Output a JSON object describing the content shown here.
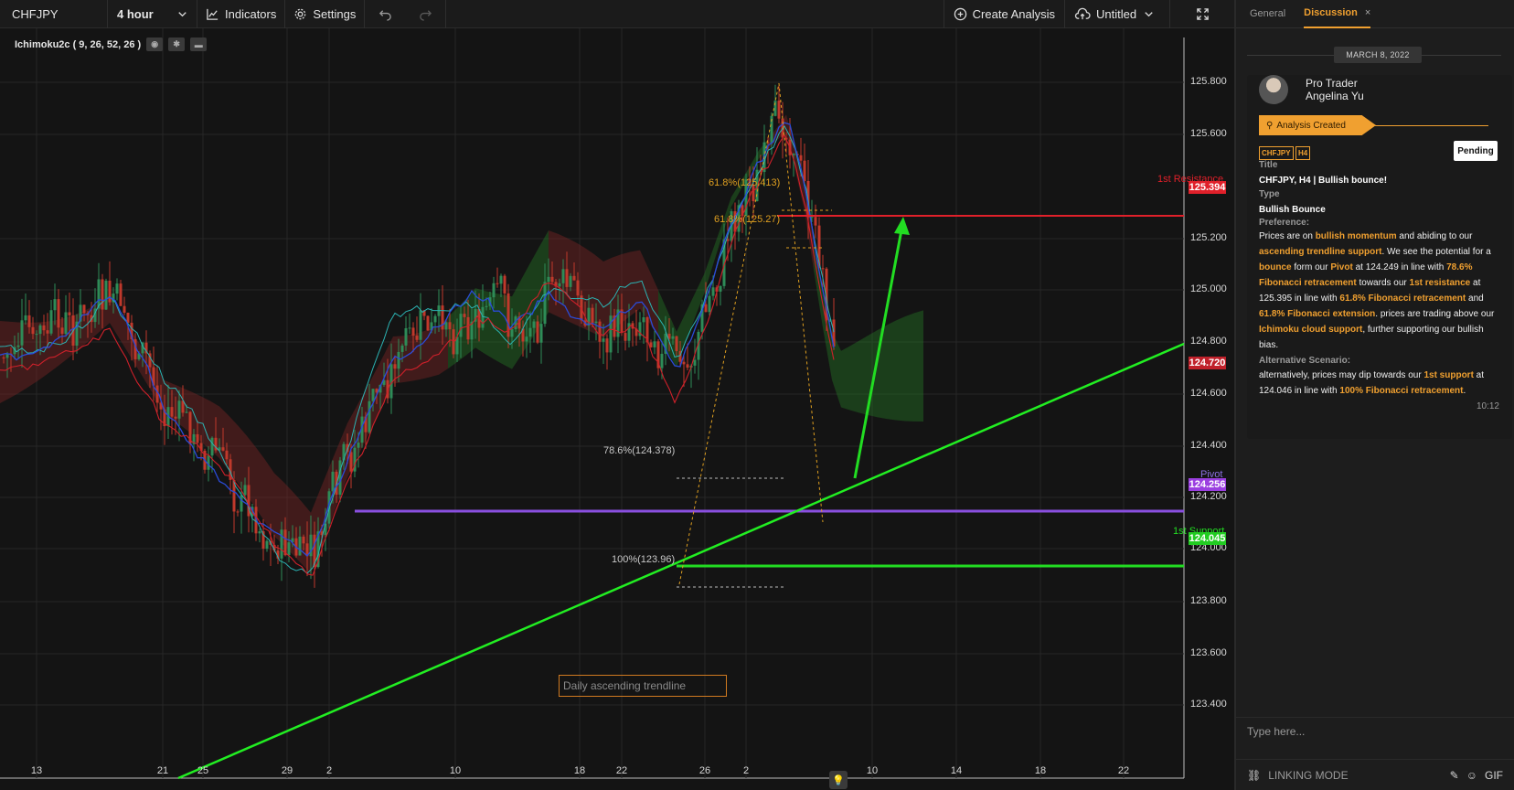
{
  "toolbar": {
    "symbol": "CHFJPY",
    "interval": "4 hour",
    "indicators_label": "Indicators",
    "settings_label": "Settings",
    "create_label": "Create Analysis",
    "layout_label": "Untitled"
  },
  "indicator": {
    "label": "Ichimoku2c ( 9, 26, 52, 26 )"
  },
  "price_axis": [
    "125.800",
    "125.600",
    "125.200",
    "125.000",
    "124.800",
    "124.600",
    "124.400",
    "124.200",
    "124.000",
    "123.800",
    "123.600",
    "123.400"
  ],
  "time_axis": [
    "13",
    "21",
    "25",
    "29",
    "2",
    "10",
    "18",
    "22",
    "26",
    "2",
    "10",
    "14",
    "18",
    "22"
  ],
  "price_tags": {
    "resistance": "125.394",
    "current": "124.720",
    "pivot": "124.256",
    "support": "124.045"
  },
  "levels": {
    "resistance": "1st Resistance",
    "pivot": "Pivot",
    "support": "1st Support"
  },
  "fib": {
    "f618": "61.8%(125.413)",
    "f50": "61.8%(125.27)",
    "f786": "78.6%(124.378)",
    "f100": "100%(123.96)"
  },
  "annotation": "Daily ascending trendline",
  "colors": {
    "resistance": "#e0202a",
    "pivot": "#8a4fe0",
    "support": "#22dd22",
    "trendline": "#22ee22",
    "accent": "#f0a030"
  },
  "sidebar": {
    "tabs": [
      "General",
      "Discussion"
    ],
    "date": "MARCH 8, 2022",
    "author_role": "Pro Trader",
    "author_name": "Angelina Yu",
    "banner": "Analysis Created",
    "tags": [
      "CHFJPY",
      "H4"
    ],
    "status": "Pending",
    "title_label": "Title",
    "title_value": "CHFJPY, H4 | Bullish bounce!",
    "type_label": "Type",
    "type_value": "Bullish Bounce",
    "preference_label": "Preference:",
    "alt_label": "Alternative Scenario:",
    "time": "10:12",
    "composer_placeholder": "Type here...",
    "linking_mode": "LINKING MODE",
    "gif": "GIF"
  },
  "preference_text": [
    [
      "Prices are on ",
      "n"
    ],
    [
      "bullish momentum",
      "h"
    ],
    [
      " and abiding to our ",
      "n"
    ],
    [
      "ascending trendline support",
      "h"
    ],
    [
      ". We see the potential for a ",
      "n"
    ],
    [
      "bounce",
      "h"
    ],
    [
      " form our ",
      "n"
    ],
    [
      "Pivot",
      "h"
    ],
    [
      " at 124.249 in line with ",
      "n"
    ],
    [
      "78.6% Fibonacci retracement",
      "h"
    ],
    [
      " towards our ",
      "n"
    ],
    [
      "1st resistance",
      "h"
    ],
    [
      " at 125.395 in line with ",
      "n"
    ],
    [
      "61.8% Fibonacci retracement",
      "h"
    ],
    [
      " and ",
      "n"
    ],
    [
      "61.8% Fibonacci extension",
      "h"
    ],
    [
      ". prices are trading above our ",
      "n"
    ],
    [
      "Ichimoku cloud support",
      "h"
    ],
    [
      ", further supporting our bullish bias.",
      "n"
    ]
  ],
  "alt_text": [
    [
      "alternatively, prices may dip towards our ",
      "n"
    ],
    [
      "1st support",
      "h"
    ],
    [
      " at 124.046 in line with ",
      "n"
    ],
    [
      "100% Fibonacci retracement",
      "h"
    ],
    [
      ".",
      "n"
    ]
  ]
}
